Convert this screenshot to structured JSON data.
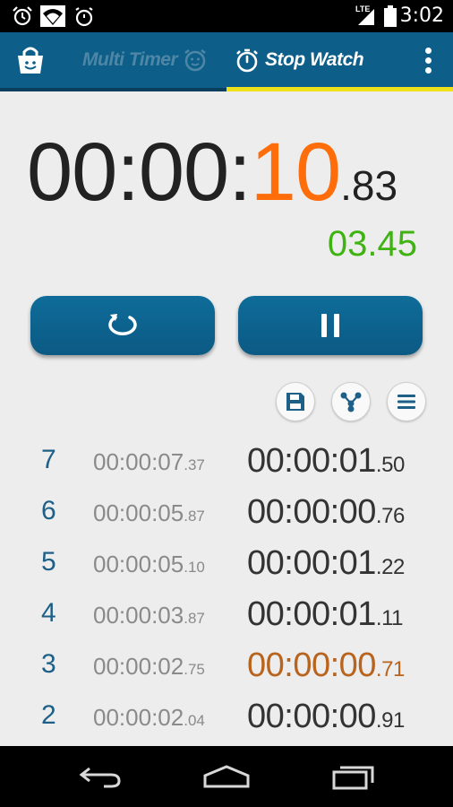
{
  "status_bar": {
    "time": "3:02",
    "network_label": "LTE",
    "icons": [
      "alarm-clock-icon",
      "wifi-icon",
      "stopwatch-icon",
      "signal-icon",
      "battery-icon"
    ]
  },
  "app_bar": {
    "tabs": [
      {
        "label": "Multi Timer",
        "icon": "alarm-face-icon"
      },
      {
        "label": "Stop Watch",
        "icon": "stopwatch-icon"
      }
    ],
    "active_tab_index": 1,
    "colors": {
      "bar": "#0d5f8a",
      "active_underline": "#f0e21a"
    }
  },
  "stopwatch": {
    "main_prefix": "00:00:",
    "main_seconds": "10",
    "main_centis": ".83",
    "split_time": "03.45",
    "colors": {
      "seconds": "#ff6c0a",
      "split": "#3fb312"
    }
  },
  "controls": {
    "reset_icon": "reset-icon",
    "pause_icon": "pause-icon",
    "small_actions": [
      "save-icon",
      "share-icon",
      "list-icon"
    ]
  },
  "laps": [
    {
      "num": "7",
      "total": "00:00:07",
      "total_cs": ".37",
      "split": "00:00:01",
      "split_cs": ".50",
      "best": false
    },
    {
      "num": "6",
      "total": "00:00:05",
      "total_cs": ".87",
      "split": "00:00:00",
      "split_cs": ".76",
      "best": false
    },
    {
      "num": "5",
      "total": "00:00:05",
      "total_cs": ".10",
      "split": "00:00:01",
      "split_cs": ".22",
      "best": false
    },
    {
      "num": "4",
      "total": "00:00:03",
      "total_cs": ".87",
      "split": "00:00:01",
      "split_cs": ".11",
      "best": false
    },
    {
      "num": "3",
      "total": "00:00:02",
      "total_cs": ".75",
      "split": "00:00:00",
      "split_cs": ".71",
      "best": true
    },
    {
      "num": "2",
      "total": "00:00:02",
      "total_cs": ".04",
      "split": "00:00:00",
      "split_cs": ".91",
      "best": false
    }
  ],
  "nav_bar": {
    "icons": [
      "back-icon",
      "home-icon",
      "recents-icon"
    ]
  }
}
